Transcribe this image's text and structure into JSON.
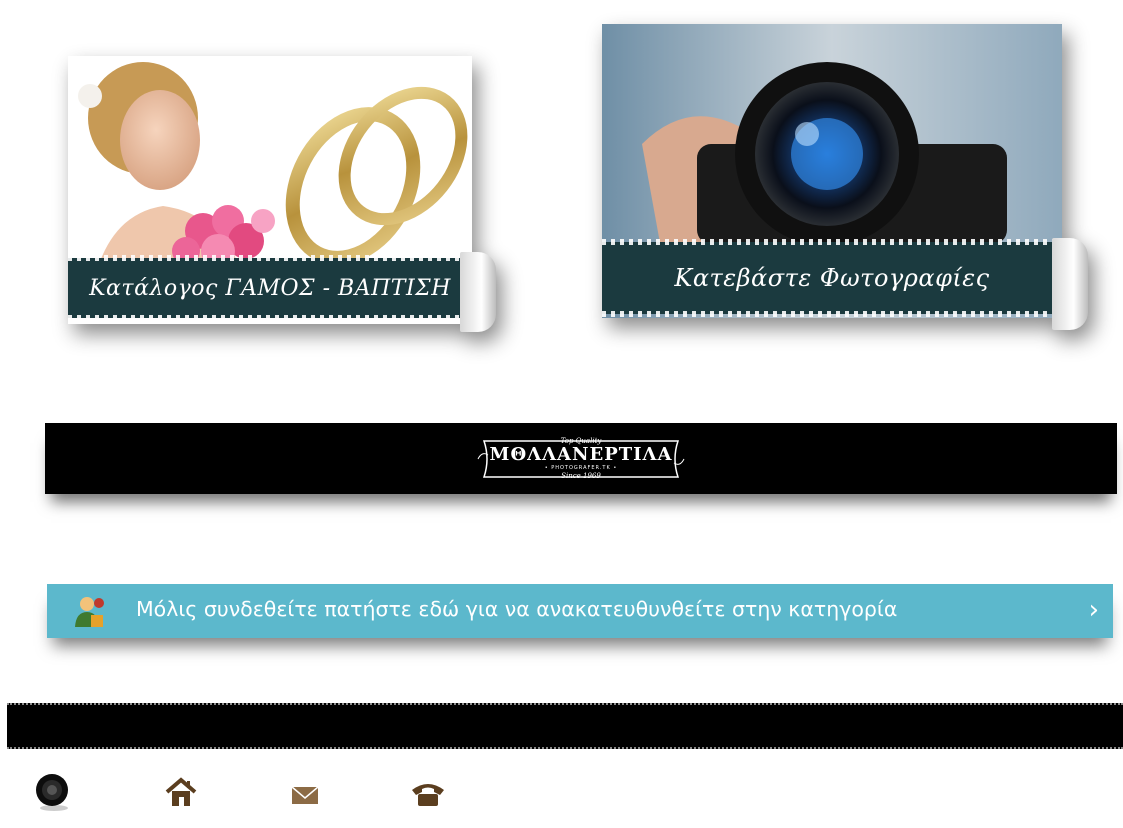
{
  "cards": [
    {
      "label": "Κατάλογος ΓΑΜΟΣ - ΒΑΠΤΙΣΗ"
    },
    {
      "label": "Κατεβάστε Φωτογραφίες"
    }
  ],
  "logo": {
    "top_text": "Top Quality",
    "main_text": "ΜΘΛΛΑΝΕΡΤΙΛΑ",
    "sub_text": "• PHOTOGRAFER.TK •",
    "bottom_text": "Since 1969"
  },
  "info_banner": {
    "text": "Μόλις συνδεθείτε πατήστε εδώ για να ανακατευθυνθείτε στην κατηγορία",
    "chevron": "›",
    "icon": "user-pin-icon",
    "color": "#5cb8cc"
  },
  "footer": {
    "icons": [
      "camera-lens-icon",
      "home-icon",
      "mail-icon",
      "phone-icon"
    ]
  },
  "colors": {
    "banner_teal_dark": "#1b3a3f",
    "bar_black": "#000000"
  }
}
